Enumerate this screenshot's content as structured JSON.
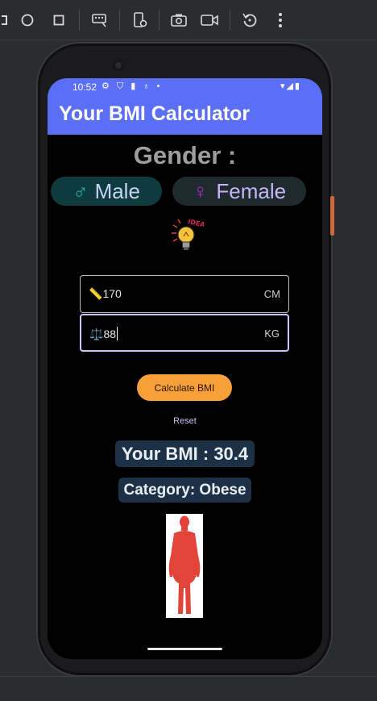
{
  "status_bar": {
    "time": "10:52"
  },
  "app": {
    "title": "Your BMI Calculator"
  },
  "gender": {
    "title": "Gender :",
    "male": {
      "symbol": "♂",
      "label": "Male"
    },
    "female": {
      "symbol": "♀",
      "label": "Female"
    }
  },
  "inputs": {
    "height": {
      "icon": "📏",
      "value": "170",
      "suffix": "CM"
    },
    "weight": {
      "icon": "⚖️",
      "value": "88",
      "suffix": "KG"
    }
  },
  "actions": {
    "calculate_label": "Calculate BMI",
    "reset_label": "Reset"
  },
  "result": {
    "bmi_text": "Your BMI : 30.4",
    "category_text": "Category: Obese"
  },
  "bulb_badge": "IDEA",
  "colors": {
    "appbar": "#5a6ff5",
    "accent_button": "#f7a03a",
    "result_bg": "#1d3146",
    "body_figure": "#e3443a"
  }
}
